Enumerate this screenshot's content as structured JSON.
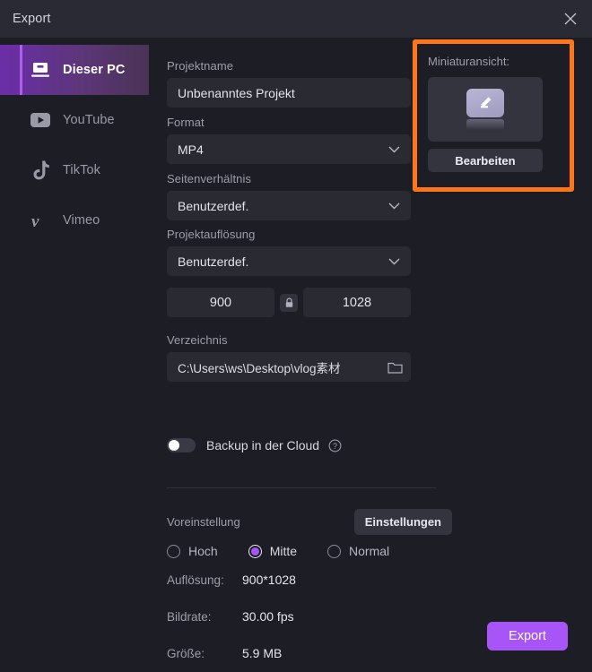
{
  "window": {
    "title": "Export",
    "close_icon": "close-icon"
  },
  "sidebar": {
    "items": [
      {
        "label": "Dieser PC",
        "icon": "desktop-pc-icon",
        "active": true
      },
      {
        "label": "YouTube",
        "icon": "youtube-icon",
        "active": false
      },
      {
        "label": "TikTok",
        "icon": "tiktok-icon",
        "active": false
      },
      {
        "label": "Vimeo",
        "icon": "vimeo-icon",
        "active": false
      }
    ]
  },
  "form": {
    "project_name": {
      "label": "Projektname",
      "value": "Unbenanntes Projekt"
    },
    "format": {
      "label": "Format",
      "value": "MP4",
      "chevron_icon": "chevron-down-icon"
    },
    "aspect_ratio": {
      "label": "Seitenverhältnis",
      "value": "Benutzerdef.",
      "chevron_icon": "chevron-down-icon"
    },
    "resolution": {
      "label": "Projektauflösung",
      "value": "Benutzerdef.",
      "chevron_icon": "chevron-down-icon",
      "width": "900",
      "height": "1028",
      "lock_icon": "lock-closed-icon"
    },
    "directory": {
      "label": "Verzeichnis",
      "value": "C:\\Users\\ws\\Desktop\\vlog素材",
      "browse_icon": "folder-icon"
    },
    "cloud_backup": {
      "label": "Backup in der Cloud",
      "enabled": false,
      "help_icon": "question-circle-icon"
    },
    "preset": {
      "label": "Voreinstellung",
      "settings_button": "Einstellungen",
      "options": [
        {
          "label": "Hoch",
          "selected": false
        },
        {
          "label": "Mitte",
          "selected": true
        },
        {
          "label": "Normal",
          "selected": false
        }
      ]
    },
    "info": [
      {
        "key": "Auflösung:",
        "value": "900*1028"
      },
      {
        "key": "Bildrate:",
        "value": "30.00 fps"
      },
      {
        "key": "Größe:",
        "value": "5.9 MB"
      }
    ]
  },
  "thumbnail": {
    "title": "Miniaturansicht:",
    "edit_icon": "pencil-edit-icon",
    "edit_button": "Bearbeiten",
    "highlight_color": "#ff7518"
  },
  "footer": {
    "export_button": "Export"
  },
  "colors": {
    "accent": "#a855f7",
    "highlight": "#ff7518",
    "titlebar_bg": "#2a2a35",
    "body_bg": "#1d1d26",
    "field_bg": "#2a2a33"
  }
}
